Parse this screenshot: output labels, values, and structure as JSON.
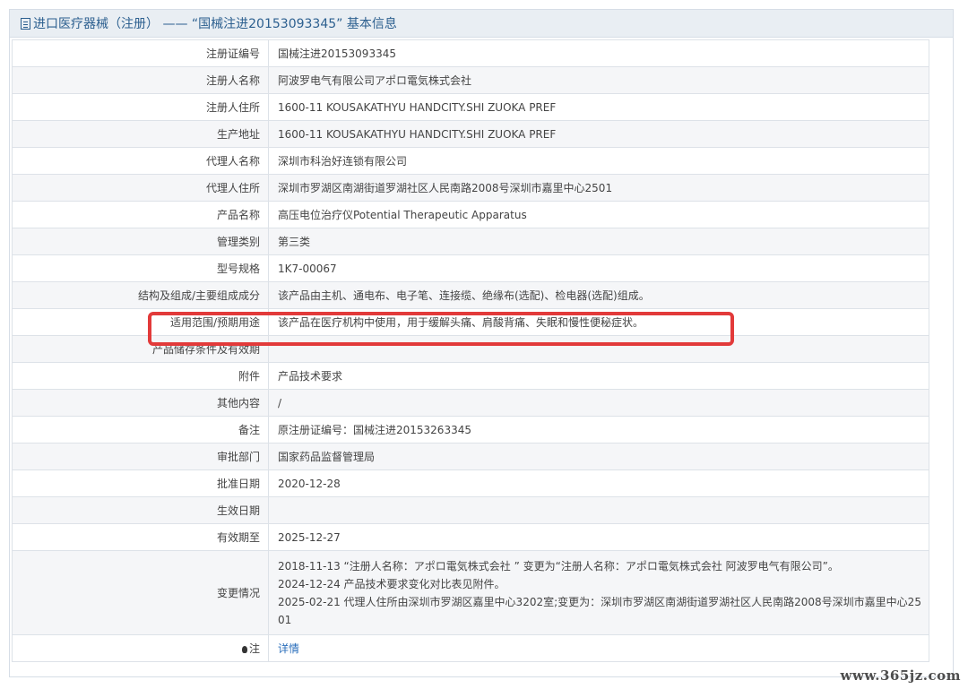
{
  "header": {
    "title": "进口医疗器械（注册） —— “国械注进20153093345” 基本信息"
  },
  "rows": [
    {
      "label": "注册证编号",
      "value": "国械注进20153093345"
    },
    {
      "label": "注册人名称",
      "value": "阿波罗电气有限公司アポロ電気株式会社"
    },
    {
      "label": "注册人住所",
      "value": "1600-11 KOUSAKATHYU HANDCITY.SHI ZUOKA PREF"
    },
    {
      "label": "生产地址",
      "value": "1600-11 KOUSAKATHYU HANDCITY.SHI ZUOKA PREF"
    },
    {
      "label": "代理人名称",
      "value": "深圳市科治好连锁有限公司"
    },
    {
      "label": "代理人住所",
      "value": "深圳市罗湖区南湖街道罗湖社区人民南路2008号深圳市嘉里中心2501"
    },
    {
      "label": "产品名称",
      "value": "高压电位治疗仪Potential Therapeutic Apparatus"
    },
    {
      "label": "管理类别",
      "value": "第三类"
    },
    {
      "label": "型号规格",
      "value": "1K7-00067"
    },
    {
      "label": "结构及组成/主要组成成分",
      "value": "该产品由主机、通电布、电子笔、连接缆、绝缘布(选配)、检电器(选配)组成。"
    },
    {
      "label": "适用范围/预期用途",
      "value": "该产品在医疗机构中使用，用于缓解头痛、肩酸背痛、失眠和慢性便秘症状。"
    },
    {
      "label": "产品储存条件及有效期",
      "value": ""
    },
    {
      "label": "附件",
      "value": "产品技术要求"
    },
    {
      "label": "其他内容",
      "value": "/"
    },
    {
      "label": "备注",
      "value": "原注册证编号：国械注进20153263345"
    },
    {
      "label": "审批部门",
      "value": "国家药品监督管理局"
    },
    {
      "label": "批准日期",
      "value": "2020-12-28"
    },
    {
      "label": "生效日期",
      "value": ""
    },
    {
      "label": "有效期至",
      "value": "2025-12-27"
    }
  ],
  "changes": {
    "label": "变更情况",
    "lines": [
      "2018-11-13 “注册人名称：アポロ電気株式会社 ” 变更为“注册人名称：アポロ電気株式会社 阿波罗电气有限公司”。",
      "2024-12-24 产品技术要求变化对比表见附件。",
      "2025-02-21 代理人住所由深圳市罗湖区嘉里中心3202室;变更为：深圳市罗湖区南湖街道罗湖社区人民南路2008号深圳市嘉里中心25 01"
    ]
  },
  "note_row": {
    "label": "注",
    "link": "详情"
  },
  "watermark": "www.365jz.com"
}
